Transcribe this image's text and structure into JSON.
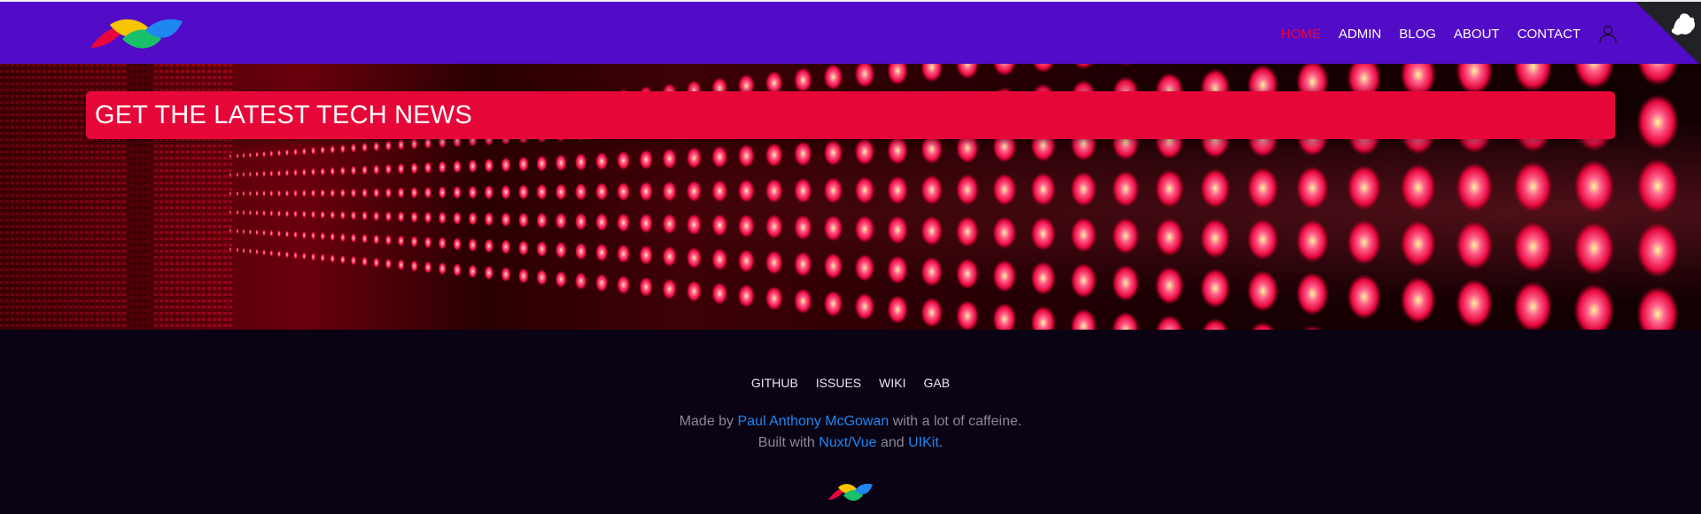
{
  "nav": {
    "items": [
      {
        "label": "HOME",
        "active": true
      },
      {
        "label": "ADMIN",
        "active": false
      },
      {
        "label": "BLOG",
        "active": false
      },
      {
        "label": "ABOUT",
        "active": false
      },
      {
        "label": "CONTACT",
        "active": false
      }
    ],
    "user_icon": "user-icon",
    "corner_icon": "github-corner-icon"
  },
  "hero": {
    "banner_title": "GET THE LATEST TECH NEWS"
  },
  "footer": {
    "links": [
      "GITHUB",
      "ISSUES",
      "WIKI",
      "GAB"
    ],
    "credits": {
      "line1_prefix": "Made by",
      "author": "Paul Anthony McGowan",
      "line1_suffix": "with a lot of caffeine.",
      "line2_prefix": "Built with",
      "framework": "Nuxt/Vue",
      "and": "and",
      "ui_kit": "UIKit",
      "period": "."
    }
  },
  "colors": {
    "navbar": "#520bc7",
    "accent": "#e60738",
    "link": "#1e87f0",
    "footer_bg": "#0a0314"
  }
}
